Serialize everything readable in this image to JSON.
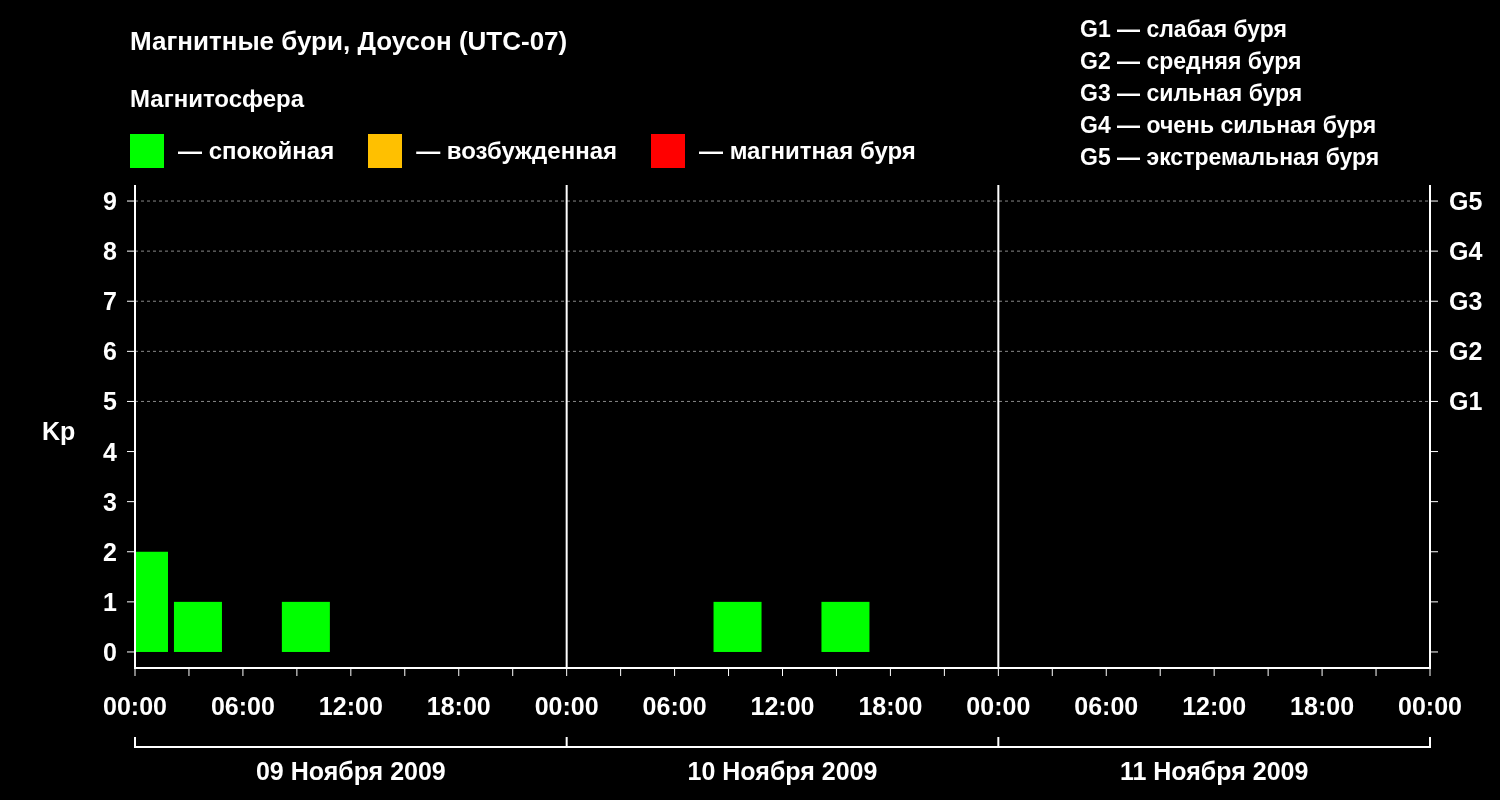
{
  "title": "Магнитные бури, Доусон (UTC-07)",
  "legend": {
    "heading": "Магнитосфера",
    "items": [
      {
        "label": "— спокойная",
        "color": "#00ff00"
      },
      {
        "label": "— возбужденная",
        "color": "#ffc000"
      },
      {
        "label": "— магнитная буря",
        "color": "#ff0000"
      }
    ]
  },
  "scale": [
    "G1 — слабая буря",
    "G2 — средняя буря",
    "G3 — сильная буря",
    "G4 — очень сильная буря",
    "G5 — экстремальная буря"
  ],
  "chart": {
    "chart_data": {
      "type": "bar",
      "ylabel": "Kp",
      "x": [
        "2009-11-09T00:30",
        "2009-11-09T03:30",
        "2009-11-09T09:30",
        "2009-11-10T09:30",
        "2009-11-10T15:30"
      ],
      "values": [
        2,
        1,
        1,
        1,
        1
      ],
      "xlim": [
        "2009-11-09T00:00",
        "2009-11-12T00:00"
      ],
      "ylim": [
        -0.32,
        9.32
      ],
      "xticks": [
        {
          "value": "2009-11-09T00:00",
          "label": "00:00"
        },
        {
          "value": "2009-11-09T06:00",
          "label": "06:00"
        },
        {
          "value": "2009-11-09T12:00",
          "label": "12:00"
        },
        {
          "value": "2009-11-09T18:00",
          "label": "18:00"
        },
        {
          "value": "2009-11-10T00:00",
          "label": "00:00"
        },
        {
          "value": "2009-11-10T06:00",
          "label": "06:00"
        },
        {
          "value": "2009-11-10T12:00",
          "label": "12:00"
        },
        {
          "value": "2009-11-10T18:00",
          "label": "18:00"
        },
        {
          "value": "2009-11-11T00:00",
          "label": "00:00"
        },
        {
          "value": "2009-11-11T06:00",
          "label": "06:00"
        },
        {
          "value": "2009-11-11T12:00",
          "label": "12:00"
        },
        {
          "value": "2009-11-11T18:00",
          "label": "18:00"
        },
        {
          "value": "2009-11-12T00:00",
          "label": "00:00"
        }
      ],
      "yticks": [
        0,
        1,
        2,
        3,
        4,
        5,
        6,
        7,
        8,
        9
      ],
      "grid": true
    },
    "storm_levels": [
      "G5",
      "G4",
      "G3",
      "G2",
      "G1"
    ],
    "days": [
      "09 Ноября 2009",
      "10 Ноября 2009",
      "11 Ноября 2009"
    ]
  }
}
